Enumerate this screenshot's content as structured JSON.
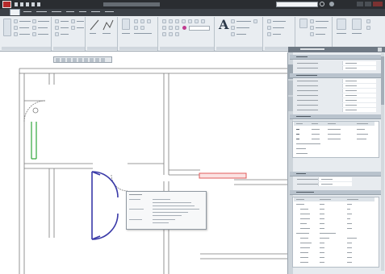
{
  "app": {
    "title": "",
    "search_placeholder": ""
  },
  "ribbon": {
    "tabs": [
      "",
      "",
      "",
      "",
      "",
      "",
      "",
      ""
    ],
    "groups": [
      "",
      "",
      "",
      "",
      "",
      "",
      "",
      "",
      ""
    ]
  },
  "canvas": {
    "float_toolbar": [
      "",
      "",
      "",
      "",
      "",
      ""
    ]
  },
  "tooltip": {
    "title": "",
    "rows": [
      {
        "label": "",
        "value": ""
      },
      {
        "label": "",
        "value": ""
      },
      {
        "label": "",
        "value": ""
      },
      {
        "label": "",
        "value": ""
      }
    ]
  },
  "palette": {
    "title": "",
    "side_tabs": [
      "",
      "",
      ""
    ],
    "sections": [
      {
        "title": "",
        "rows": [
          "",
          ""
        ]
      },
      {
        "title": "",
        "rows": [
          "",
          "",
          "",
          "",
          "",
          "",
          ""
        ]
      },
      {
        "title": "",
        "rows": [],
        "columns": [
          "",
          "",
          "",
          ""
        ]
      },
      {
        "title": "",
        "rows": [
          "",
          ""
        ]
      },
      {
        "title": "",
        "rows": [
          "",
          "",
          "",
          "",
          "",
          "",
          "",
          "",
          "",
          "",
          "",
          "",
          "",
          ""
        ]
      }
    ]
  },
  "colors": {
    "app_frame": "#2a2d31",
    "ribbon_bg": "#e9edf1",
    "door_highlight": "#3a3aa8",
    "wall_selected": "#2fa63a",
    "wall_highlight": "#e05b5b",
    "palette_bg": "#e7ebef"
  }
}
